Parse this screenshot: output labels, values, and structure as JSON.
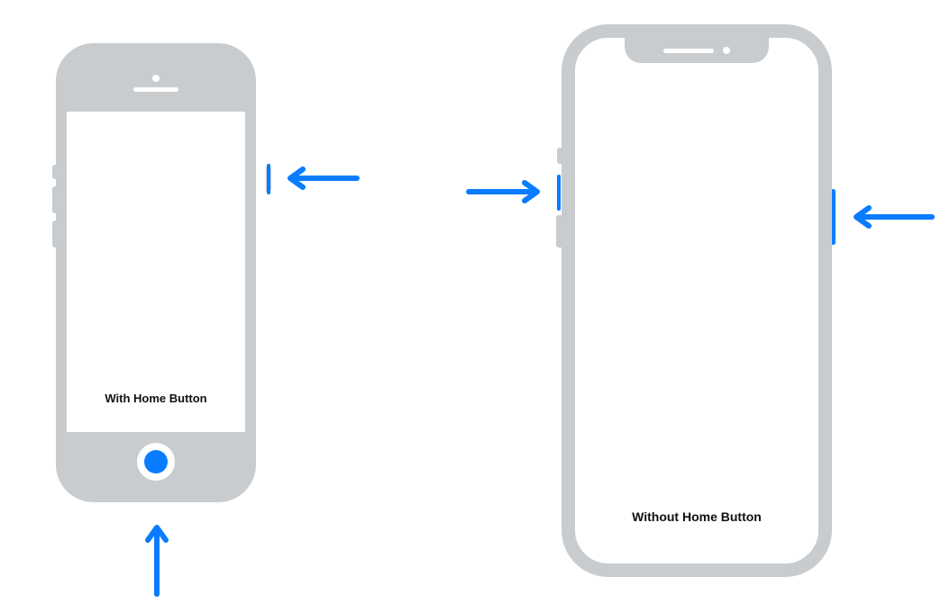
{
  "phone_with_home": {
    "label": "With Home Button",
    "indicators": [
      "side-button",
      "home-button"
    ]
  },
  "phone_without_home": {
    "label": "Without Home Button",
    "indicators": [
      "volume-button",
      "side-button"
    ]
  },
  "colors": {
    "accent": "#0a7cff",
    "device": "#c9cccf"
  }
}
